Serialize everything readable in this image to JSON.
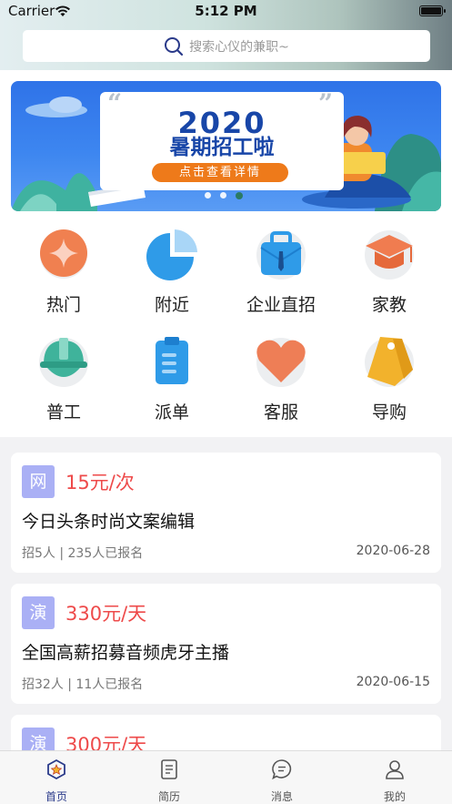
{
  "status": {
    "carrier": "Carrier",
    "time": "5:12 PM"
  },
  "search": {
    "placeholder": "搜索心仪的兼职~"
  },
  "banner": {
    "title": "2020",
    "subtitle": "暑期招工啦",
    "button": "点击查看详情",
    "quote_left": "“",
    "quote_right": "”",
    "active_dot": 3
  },
  "categories": [
    {
      "label": "热门",
      "icon": "hot-icon",
      "color": "#f08050"
    },
    {
      "label": "附近",
      "icon": "pie-chart-icon",
      "color": "#2f9be8"
    },
    {
      "label": "企业直招",
      "icon": "briefcase-icon",
      "color": "#2f9be8"
    },
    {
      "label": "家教",
      "icon": "graduation-cap-icon",
      "color": "#f07c50"
    },
    {
      "label": "普工",
      "icon": "hard-hat-icon",
      "color": "#3fb39b"
    },
    {
      "label": "派单",
      "icon": "clipboard-icon",
      "color": "#2f9be8"
    },
    {
      "label": "客服",
      "icon": "heart-icon",
      "color": "#ee7e56"
    },
    {
      "label": "导购",
      "icon": "price-tag-icon",
      "color": "#f2b22c"
    }
  ],
  "jobs": [
    {
      "tag": "网",
      "price": "15元/次",
      "title": "今日头条时尚文案编辑",
      "meta": "招5人 | 235人已报名",
      "date": "2020-06-28"
    },
    {
      "tag": "演",
      "price": "330元/天",
      "title": "全国高薪招募音频虎牙主播",
      "meta": "招32人 | 11人已报名",
      "date": "2020-06-15"
    },
    {
      "tag": "演",
      "price": "300元/天",
      "title": "",
      "meta": "",
      "date": ""
    }
  ],
  "tabs": [
    {
      "label": "首页",
      "icon": "home-star-icon",
      "active": true
    },
    {
      "label": "简历",
      "icon": "resume-icon",
      "active": false
    },
    {
      "label": "消息",
      "icon": "message-icon",
      "active": false
    },
    {
      "label": "我的",
      "icon": "profile-icon",
      "active": false
    }
  ],
  "colors": {
    "accent": "#2a3a8a",
    "price": "#ee4a4a",
    "tag": "#aab0f5"
  }
}
